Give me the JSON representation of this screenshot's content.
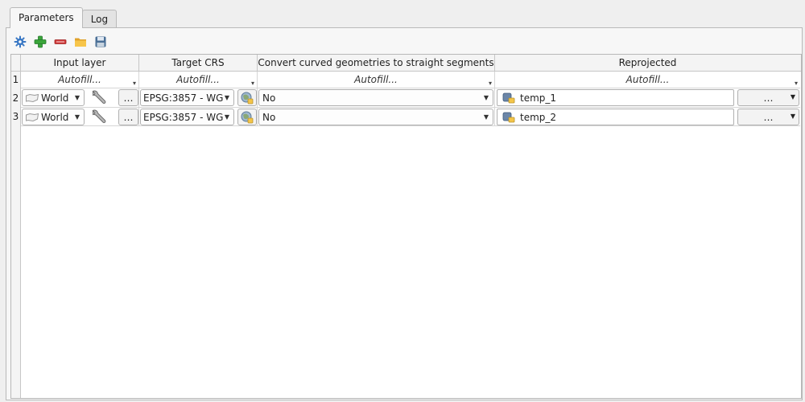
{
  "tabs": [
    {
      "label": "Parameters",
      "active": true
    },
    {
      "label": "Log",
      "active": false
    }
  ],
  "toolbar": {
    "icons": [
      "settings-icon",
      "add-row-icon",
      "remove-row-icon",
      "open-folder-icon",
      "save-icon"
    ]
  },
  "table": {
    "columns": [
      "Input layer",
      "Target CRS",
      "Convert curved geometries to straight segments",
      "Reprojected"
    ],
    "row_numbers": [
      "1",
      "2",
      "3"
    ],
    "autofill_label": "Autofill...",
    "rows": [
      {
        "input_layer": "World",
        "browse": "…",
        "target_crs": "EPSG:3857 - WG",
        "convert": "No",
        "output": "temp_1",
        "output_browse": "…"
      },
      {
        "input_layer": "World",
        "browse": "…",
        "target_crs": "EPSG:3857 - WG",
        "convert": "No",
        "output": "temp_2",
        "output_browse": "…"
      }
    ]
  },
  "colors": {
    "accent_blue": "#3a78c4",
    "add_green": "#3aa53a",
    "remove_red": "#d13a3a",
    "folder_yellow": "#f1b73c"
  }
}
